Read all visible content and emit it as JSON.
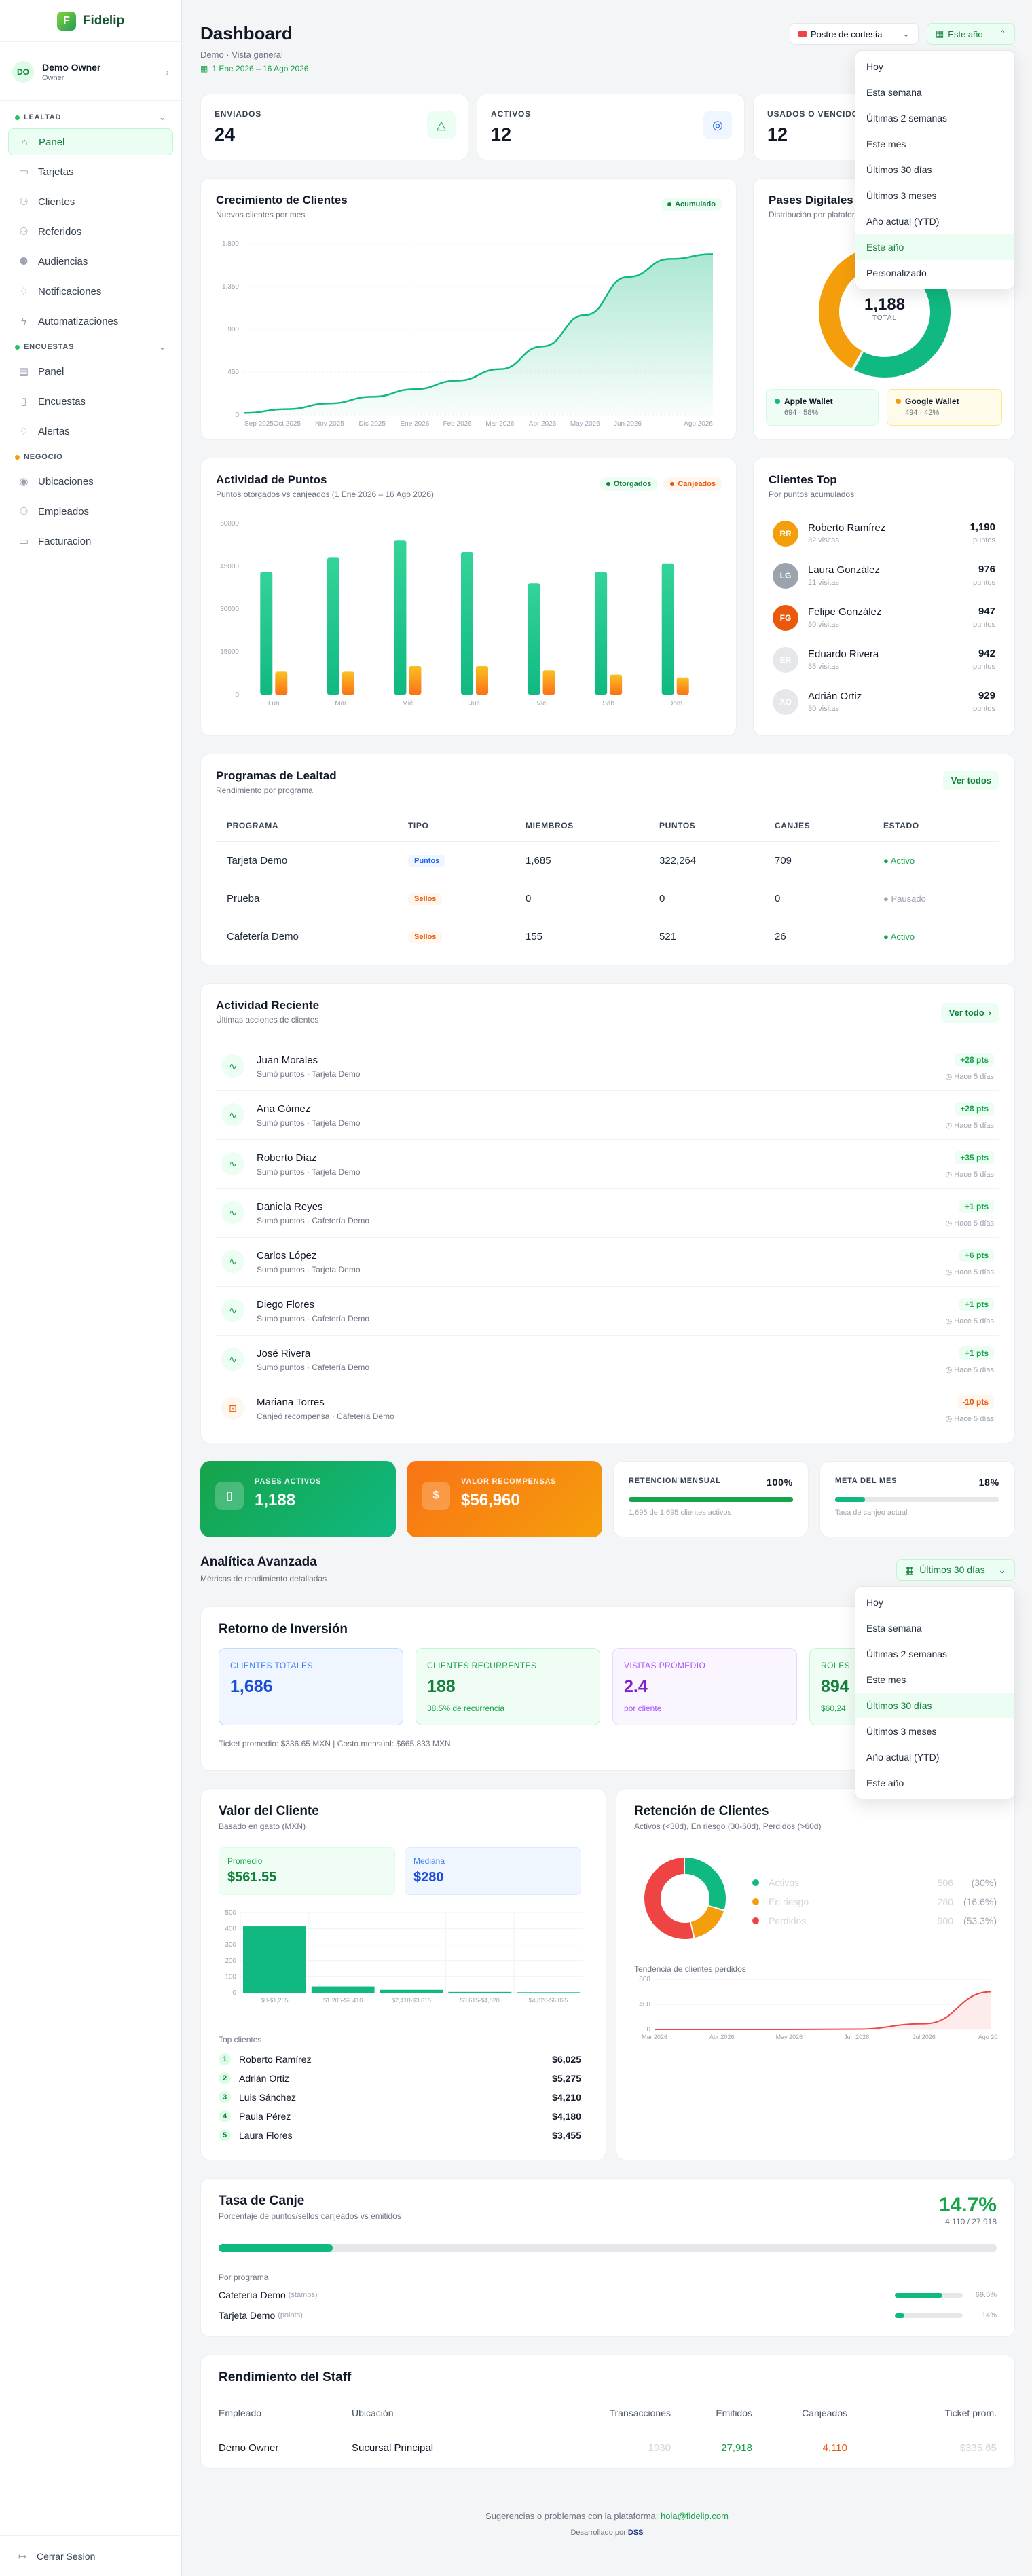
{
  "brand": {
    "name": "Fidelip"
  },
  "user": {
    "initials": "DO",
    "name": "Demo Owner",
    "role": "Owner"
  },
  "sidebar": {
    "sections": [
      {
        "title": "LEALTAD",
        "items": [
          "Panel",
          "Tarjetas",
          "Clientes",
          "Referidos",
          "Audiencias",
          "Notificaciones",
          "Automatizaciones"
        ]
      },
      {
        "title": "ENCUESTAS",
        "items": [
          "Panel",
          "Encuestas",
          "Alertas"
        ]
      },
      {
        "title": "NEGOCIO",
        "items": [
          "Ubicaciones",
          "Empleados",
          "Facturacion"
        ]
      }
    ],
    "logout": "Cerrar Sesion"
  },
  "header": {
    "title": "Dashboard",
    "subtitle": "Demo · Vista general",
    "date_range": "1 Ene 2026 – 16 Ago 2026",
    "location_select": "Postre de cortesía",
    "period_select": "Este año"
  },
  "period_dropdown": {
    "options": [
      "Hoy",
      "Esta semana",
      "Últimas 2 semanas",
      "Este mes",
      "Últimos 30 días",
      "Últimos 3 meses",
      "Año actual (YTD)",
      "Este año",
      "Personalizado"
    ],
    "selected": "Este año"
  },
  "kpis": [
    {
      "label": "ENVIADOS",
      "value": "24"
    },
    {
      "label": "ACTIVOS",
      "value": "12"
    },
    {
      "label": "USADOS O VENCIDOS",
      "value": "12"
    }
  ],
  "growth": {
    "title": "Crecimiento de Clientes",
    "subtitle": "Nuevos clientes por mes",
    "badge": "Acumulado",
    "chart_data": {
      "type": "area",
      "x": [
        "Sep 2025",
        "Oct 2025",
        "Nov 2025",
        "Dic 2025",
        "Ene 2026",
        "Feb 2026",
        "Mar 2026",
        "Abr 2026",
        "May 2026",
        "Jun 2026",
        "Jul 2026",
        "Ago 2026"
      ],
      "values": [
        20,
        60,
        120,
        190,
        270,
        360,
        480,
        720,
        1050,
        1450,
        1640,
        1690
      ],
      "yticks": [
        0,
        450,
        900,
        1350,
        1800
      ],
      "ylim": [
        0,
        1800
      ]
    }
  },
  "passes": {
    "title": "Pases Digitales",
    "subtitle": "Distribución por plataforma",
    "total": "1,188",
    "total_label": "TOTAL",
    "chart_data": {
      "type": "pie",
      "categories": [
        "Apple Wallet",
        "Google Wallet"
      ],
      "values": [
        694,
        494
      ]
    },
    "legend": [
      {
        "name": "Apple Wallet",
        "detail": "694 · 58%"
      },
      {
        "name": "Google Wallet",
        "detail": "494 · 42%"
      }
    ]
  },
  "points": {
    "title": "Actividad de Puntos",
    "subtitle": "Puntos otorgados vs canjeados (1 Ene 2026 – 16 Ago 2026)",
    "legend": [
      "Otorgados",
      "Canjeados"
    ],
    "chart_data": {
      "type": "bar",
      "categories": [
        "Lun",
        "Mar",
        "Mié",
        "Jue",
        "Vie",
        "Sáb",
        "Dom"
      ],
      "series": [
        {
          "name": "Otorgados",
          "values": [
            43000,
            48000,
            54000,
            50000,
            39000,
            43000,
            46000
          ]
        },
        {
          "name": "Canjeados",
          "values": [
            8000,
            8000,
            10000,
            10000,
            8500,
            7000,
            6000
          ]
        }
      ],
      "yticks": [
        0,
        15000,
        30000,
        45000,
        60000
      ],
      "ylim": [
        0,
        60000
      ]
    }
  },
  "top_clients": {
    "title": "Clientes Top",
    "subtitle": "Por puntos acumulados",
    "points_label": "puntos",
    "rows": [
      {
        "initials": "RR",
        "name": "Roberto Ramírez",
        "visits": "32 visitas",
        "points": "1,190"
      },
      {
        "initials": "LG",
        "name": "Laura González",
        "visits": "21 visitas",
        "points": "976"
      },
      {
        "initials": "FG",
        "name": "Felipe González",
        "visits": "30 visitas",
        "points": "947"
      },
      {
        "initials": "ER",
        "name": "Eduardo Rivera",
        "visits": "35 visitas",
        "points": "942"
      },
      {
        "initials": "AO",
        "name": "Adrián Ortiz",
        "visits": "30 visitas",
        "points": "929"
      }
    ]
  },
  "programs": {
    "title": "Programas de Lealtad",
    "subtitle": "Rendimiento por programa",
    "view_all": "Ver todos",
    "columns": [
      "PROGRAMA",
      "TIPO",
      "MIEMBROS",
      "PUNTOS",
      "CANJES",
      "ESTADO"
    ],
    "rows": [
      {
        "name": "Tarjeta Demo",
        "type": "Puntos",
        "members": "1,685",
        "points": "322,264",
        "redemptions": "709",
        "status": "Activo"
      },
      {
        "name": "Prueba",
        "type": "Sellos",
        "members": "0",
        "points": "0",
        "redemptions": "0",
        "status": "Pausado"
      },
      {
        "name": "Cafetería Demo",
        "type": "Sellos",
        "members": "155",
        "points": "521",
        "redemptions": "26",
        "status": "Activo"
      }
    ]
  },
  "activity": {
    "title": "Actividad Reciente",
    "subtitle": "Últimas acciones de clientes",
    "view_all": "Ver todo",
    "rows": [
      {
        "name": "Juan Morales",
        "desc": "Sumó puntos · Tarjeta Demo",
        "pts": "+28 pts",
        "time": "Hace 5 días"
      },
      {
        "name": "Ana Gómez",
        "desc": "Sumó puntos · Tarjeta Demo",
        "pts": "+28 pts",
        "time": "Hace 5 días"
      },
      {
        "name": "Roberto Díaz",
        "desc": "Sumó puntos · Tarjeta Demo",
        "pts": "+35 pts",
        "time": "Hace 5 días"
      },
      {
        "name": "Daniela Reyes",
        "desc": "Sumó puntos · Cafetería Demo",
        "pts": "+1 pts",
        "time": "Hace 5 días"
      },
      {
        "name": "Carlos López",
        "desc": "Sumó puntos · Tarjeta Demo",
        "pts": "+6 pts",
        "time": "Hace 5 días"
      },
      {
        "name": "Diego Flores",
        "desc": "Sumó puntos · Cafetería Demo",
        "pts": "+1 pts",
        "time": "Hace 5 días"
      },
      {
        "name": "José Rivera",
        "desc": "Sumó puntos · Cafetería Demo",
        "pts": "+1 pts",
        "time": "Hace 5 días"
      },
      {
        "name": "Mariana Torres",
        "desc": "Canjeó recompensa · Cafetería Demo",
        "pts": "-10 pts",
        "time": "Hace 5 días"
      }
    ]
  },
  "summary": {
    "active_passes": {
      "label": "PASES ACTIVOS",
      "value": "1,188"
    },
    "rewards_value": {
      "label": "VALOR RECOMPENSAS",
      "value": "$56,960"
    },
    "retention": {
      "label": "RETENCION MENSUAL",
      "value": "100%",
      "detail": "1,695 de 1,695 clientes activos",
      "fill": 1.0
    },
    "goal": {
      "label": "META DEL MES",
      "value": "18%",
      "detail": "Tasa de canjeo actual",
      "fill": 0.18
    }
  },
  "advanced": {
    "title": "Analítica Avanzada",
    "subtitle": "Métricas de rendimiento detalladas",
    "period_select": "Últimos 30 días",
    "dropdown": {
      "options": [
        "Hoy",
        "Esta semana",
        "Últimas 2 semanas",
        "Este mes",
        "Últimos 30 días",
        "Últimos 3 meses",
        "Año actual (YTD)",
        "Este año"
      ],
      "selected": "Últimos 30 días"
    }
  },
  "roi": {
    "title": "Retorno de Inversión",
    "boxes": [
      {
        "label": "CLIENTES TOTALES",
        "value": "1,686",
        "sub": ""
      },
      {
        "label": "CLIENTES RECURRENTES",
        "value": "188",
        "sub": "38.5% de recurrencia"
      },
      {
        "label": "VISITAS PROMEDIO",
        "value": "2.4",
        "sub": "por cliente"
      },
      {
        "label": "ROI ES",
        "value": "894",
        "sub": "$60,24"
      }
    ],
    "footnote": "Ticket promedio: $336.65 MXN | Costo mensual: $665.833 MXN"
  },
  "customer_value": {
    "title": "Valor del Cliente",
    "subtitle": "Basado en gasto (MXN)",
    "avg_label": "Promedio",
    "avg_value": "$561.55",
    "median_label": "Mediana",
    "median_value": "$280",
    "chart_data": {
      "type": "bar",
      "categories": [
        "$0-$1,205",
        "$1,205-$2,410",
        "$2,410-$3,615",
        "$3,615-$4,820",
        "$4,820-$6,025"
      ],
      "values": [
        415,
        40,
        18,
        5,
        3
      ],
      "yticks": [
        0,
        100,
        200,
        300,
        400,
        500
      ],
      "ylim": [
        0,
        500
      ]
    },
    "top_title": "Top clientes",
    "top": [
      {
        "rank": "1",
        "name": "Roberto Ramírez",
        "value": "$6,025"
      },
      {
        "rank": "2",
        "name": "Adrián Ortiz",
        "value": "$5,275"
      },
      {
        "rank": "3",
        "name": "Luis Sánchez",
        "value": "$4,210"
      },
      {
        "rank": "4",
        "name": "Paula Pérez",
        "value": "$4,180"
      },
      {
        "rank": "5",
        "name": "Laura Flores",
        "value": "$3,455"
      }
    ]
  },
  "retention": {
    "title": "Retención de Clientes",
    "subtitle": "Activos (<30d), En riesgo (30-60d), Perdidos (>60d)",
    "chart_data": {
      "type": "pie",
      "categories": [
        "Activos",
        "En riesgo",
        "Perdidos"
      ],
      "values": [
        30,
        16.6,
        53.3
      ]
    },
    "legend": [
      {
        "name": "Activos",
        "count": "506",
        "pct": "(30%)"
      },
      {
        "name": "En riesgo",
        "count": "280",
        "pct": "(16.6%)"
      },
      {
        "name": "Perdidos",
        "count": "900",
        "pct": "(53.3%)"
      }
    ],
    "trend_title": "Tendencia de clientes perdidos",
    "trend_chart": {
      "type": "line",
      "x": [
        "Mar 2026",
        "Abr 2026",
        "May 2026",
        "Jun 2026",
        "Jul 2026",
        "Ago 2026"
      ],
      "values": [
        0,
        0,
        0,
        5,
        90,
        600
      ],
      "yticks": [
        0,
        400,
        800
      ],
      "ylim": [
        0,
        800
      ]
    }
  },
  "redemption": {
    "title": "Tasa de Canje",
    "subtitle": "Porcentaje de puntos/sellos canjeados vs emitidos",
    "rate": "14.7%",
    "detail": "4,110 / 27,918",
    "fill": 0.147,
    "by_program_label": "Por programa",
    "programs": [
      {
        "name": "Cafetería Demo",
        "type": "(stamps)",
        "pct": "69.5%",
        "fill": 0.695
      },
      {
        "name": "Tarjeta Demo",
        "type": "(points)",
        "pct": "14%",
        "fill": 0.14
      }
    ]
  },
  "staff": {
    "title": "Rendimiento del Staff",
    "columns": [
      "Empleado",
      "Ubicación",
      "Transacciones",
      "Emitidos",
      "Canjeados",
      "Ticket prom."
    ],
    "rows": [
      {
        "employee": "Demo Owner",
        "location": "Sucursal Principal",
        "transactions": "1930",
        "issued": "27,918",
        "redeemed": "4,110",
        "ticket": "$335.65"
      }
    ]
  },
  "footer": {
    "line1": "Sugerencias o problemas con la plataforma:",
    "email": "hola@fidelip.com",
    "line2": "Desarrollado por",
    "dev": "DSS"
  },
  "colors": {
    "primary": "#10b981",
    "orange": "#f59e0b",
    "red": "#ef4444",
    "blue": "#2563eb",
    "purple": "#9333ea"
  }
}
